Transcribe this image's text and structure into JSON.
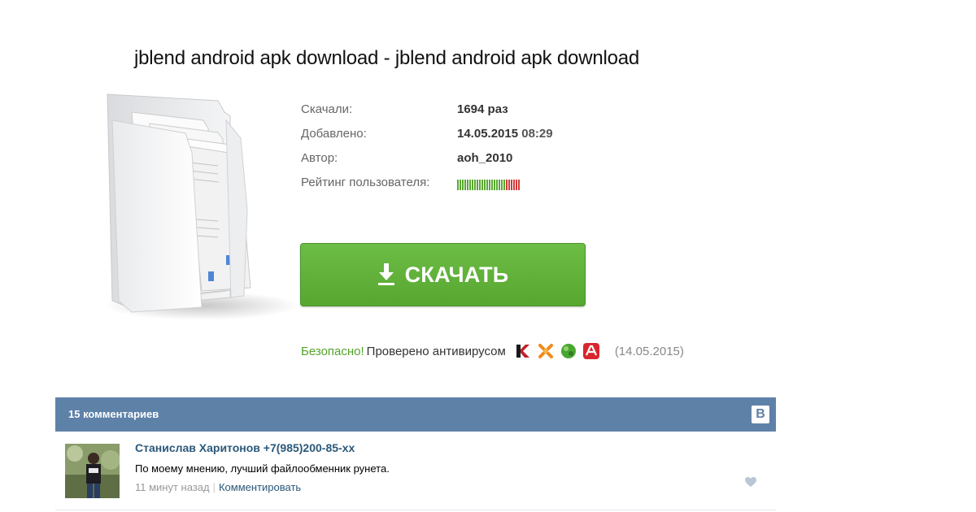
{
  "page": {
    "title": "jblend android apk download - jblend android apk download"
  },
  "file_info": {
    "downloads_label": "Скачали:",
    "downloads_value": "1694 раз",
    "added_label": "Добавлено:",
    "added_date": "14.05.2015",
    "added_time": "08:29",
    "author_label": "Автор:",
    "author_value": "aoh_2010",
    "rating_label": "Рейтинг пользователя:",
    "rating_good_fraction": 0.78
  },
  "download_button": {
    "label": "СКАЧАТЬ",
    "color": "#5cb036"
  },
  "safety": {
    "safe_word": "Безопасно!",
    "checked_text": "Проверено антивирусом",
    "date": "(14.05.2015)",
    "antivirus_icons": [
      "kaspersky-icon",
      "avast-icon",
      "dr-web-icon",
      "avira-icon"
    ]
  },
  "comments": {
    "count_label": "15 комментариев",
    "vk_logo_text": "В",
    "items": [
      {
        "author": "Станислав  Харитонов +7(985)200-85-xx",
        "text": "По моему мнению, лучший файлообменник рунета.",
        "time": "11 минут назад",
        "separator": "|",
        "reply_label": "Комментировать"
      }
    ]
  },
  "colors": {
    "accent_green": "#52a529",
    "comments_bar": "#5e81a8",
    "link_blue": "#2b587a"
  }
}
